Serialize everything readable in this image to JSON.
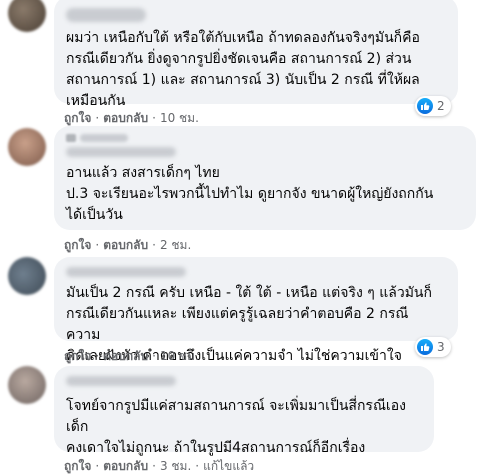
{
  "comments": [
    {
      "text": "ผมว่า เหนือกับใต้ หรือใต้กับเหนือ ถ้าทดลองกันจริงๆมันก็คือ\nกรณีเดียวกัน ยิ่งดูจากรูปยิ่งชัดเจนคือ สถานการณ์ 2) ส่วน\nสถานการณ์ 1) และ สถานการณ์ 3) นับเป็น 2 กรณี ที่ให้ผล\nเหมือนกัน",
      "like_label": "ถูกใจ",
      "reply_label": "ตอบกลับ",
      "time": "10 ชม.",
      "reactions": "2"
    },
    {
      "text": "อานแล้ว สงสารเด็กๆ ไทย\nป.3 จะเรียนอะไรพวกนี้ไปทำไม ดูยากจัง ขนาดผู้ใหญ่ยังถกกัน\nได้เป็นวัน",
      "like_label": "ถูกใจ",
      "reply_label": "ตอบกลับ",
      "time": "2 ชม."
    },
    {
      "text": "มันเป็น 2 กรณี ครับ เหนือ - ใต้ ใต้ - เหนือ แต่จริง ๆ แล้วมันก็\nกรณีเดียวกันแหละ เพียงแต่ครูรู้เฉลยว่าคำตอบคือ 2 กรณี ความ\nคิดเลยฝังหัว คำตอบจึงเป็นแค่ความจำ ไม่ใช่ความเข้าใจ",
      "like_label": "ถูกใจ",
      "reply_label": "ตอบกลับ",
      "time": "10 ชม.",
      "reactions": "3"
    },
    {
      "text": "โจทย์จากรูปมีแค่สามสถานการณ์ จะเพิ่มมาเป็นสี่กรณีเอง เด็ก\nคงเดาใจไม่ถูกนะ ถ้าในรูปมี4สถานการณ์ก็อีกเรื่อง",
      "like_label": "ถูกใจ",
      "reply_label": "ตอบกลับ",
      "time": "3 ชม.",
      "edited_label": "แก้ไขแล้ว"
    }
  ],
  "colors": {
    "bubble": "#f0f2f5",
    "meta_text": "#65676b",
    "like_blue": "#1877f2"
  }
}
